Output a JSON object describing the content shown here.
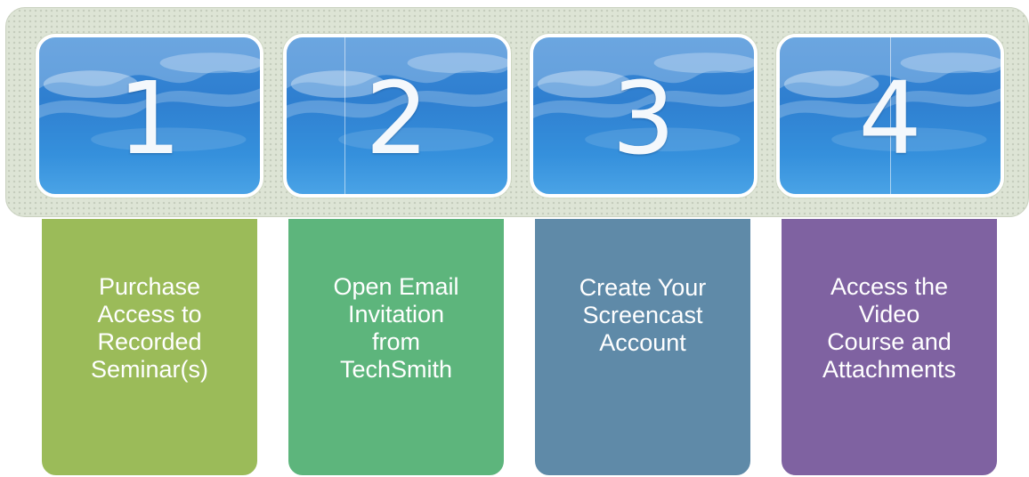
{
  "steps": [
    {
      "number": "1",
      "label_lines": [
        "Purchase",
        "Access to",
        "Recorded",
        "Seminar(s)"
      ],
      "color": "#9bbb59"
    },
    {
      "number": "2",
      "label_lines": [
        "Open Email",
        "Invitation",
        "from",
        "TechSmith"
      ],
      "color": "#5db57c"
    },
    {
      "number": "3",
      "label_lines": [
        "Create Your",
        "Screencast",
        "Account"
      ],
      "color": "#5f8aa8"
    },
    {
      "number": "4",
      "label_lines": [
        "Access the",
        "Video",
        "Course and",
        "Attachments"
      ],
      "color": "#7f62a1"
    }
  ],
  "tile_background": "sky-clouds-image",
  "band_color": "#dde4d5"
}
